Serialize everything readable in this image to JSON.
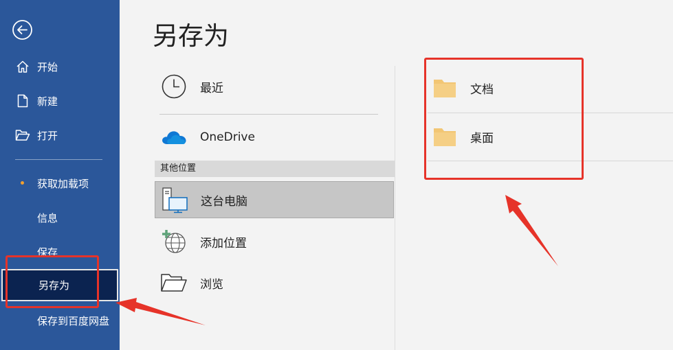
{
  "sidebar": {
    "back": "back-arrow-icon",
    "items": [
      {
        "label": "开始",
        "icon": "home-icon"
      },
      {
        "label": "新建",
        "icon": "new-document-icon"
      },
      {
        "label": "打开",
        "icon": "open-folder-icon"
      },
      {
        "label": "获取加载项",
        "icon": "dot"
      },
      {
        "label": "信息"
      },
      {
        "label": "保存"
      },
      {
        "label": "另存为"
      },
      {
        "label": "保存到百度网盘"
      }
    ]
  },
  "main": {
    "title": "另存为",
    "locations": [
      {
        "label": "最近",
        "icon": "clock-icon"
      },
      {
        "label": "OneDrive",
        "icon": "onedrive-cloud-icon"
      }
    ],
    "other_locations_header": "其他位置",
    "other_locations": [
      {
        "label": "这台电脑",
        "icon": "computer-icon"
      },
      {
        "label": "添加位置",
        "icon": "add-location-globe-icon"
      },
      {
        "label": "浏览",
        "icon": "folder-open-icon"
      }
    ],
    "folders": [
      {
        "label": "文档",
        "icon": "folder-icon"
      },
      {
        "label": "桌面",
        "icon": "folder-icon"
      }
    ]
  },
  "colors": {
    "sidebar_bg": "#2b579a",
    "active_bg": "#0b2350",
    "annotation_red": "#e63329",
    "folder_yellow": "#f2c674",
    "addin_dot": "#f0a030"
  }
}
